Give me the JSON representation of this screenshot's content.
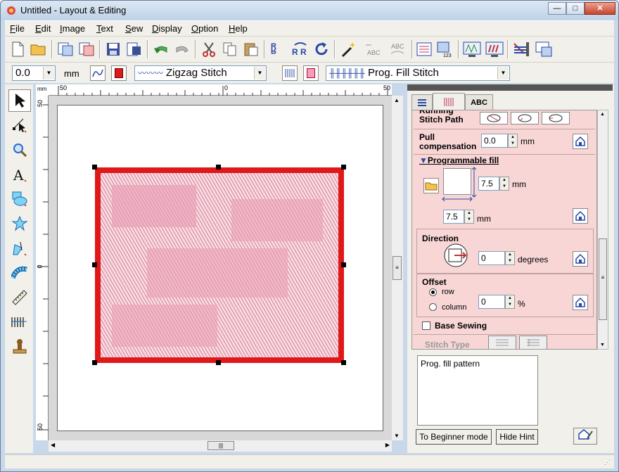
{
  "window": {
    "title": "Untitled - Layout & Editing",
    "minimize_label": "—",
    "maximize_label": "□",
    "close_label": "✕"
  },
  "menu": [
    {
      "key": "F",
      "rest": "ile"
    },
    {
      "key": "E",
      "rest": "dit"
    },
    {
      "key": "I",
      "rest": "mage"
    },
    {
      "key": "T",
      "rest": "ext"
    },
    {
      "key": "S",
      "rest": "ew"
    },
    {
      "key": "D",
      "rest": "isplay"
    },
    {
      "key": "O",
      "rest": "ption"
    },
    {
      "key": "H",
      "rest": "elp"
    }
  ],
  "toolbar2": {
    "size_value": "0.0",
    "unit": "mm",
    "line_stitch": "Zigzag Stitch",
    "region_stitch": "Prog. Fill Stitch"
  },
  "rulers": {
    "h_left": "50",
    "h_mid": "0",
    "h_right": "50",
    "v_top": "50",
    "v_mid": "0",
    "v_bottom": "50",
    "corner": "mm"
  },
  "tabs": {
    "text_tab": "ABC"
  },
  "properties": {
    "running_path_label": "Running\nStitch Path",
    "running_path_line2": "Stitch Path",
    "pull_comp_label1": "Pull",
    "pull_comp_label2": "compensation",
    "pull_comp_value": "0.0",
    "pull_comp_unit": "mm",
    "prog_fill_heading": "Programmable fill",
    "prog_fill_height": "7.5",
    "prog_fill_height_unit": "mm",
    "prog_fill_width": "7.5",
    "prog_fill_width_unit": "mm",
    "direction_label": "Direction",
    "direction_value": "0",
    "direction_unit": "degrees",
    "offset_label": "Offset",
    "offset_row": "row",
    "offset_column": "column",
    "offset_value": "0",
    "offset_unit": "%",
    "base_sewing_label": "Base Sewing",
    "stitch_type_label": "Stitch Type"
  },
  "hint": {
    "text": "Prog. fill pattern"
  },
  "buttons": {
    "beginner": "To Beginner mode",
    "hide_hint": "Hide Hint"
  },
  "colors": {
    "fill": "#e07890",
    "outline": "#e01818",
    "panel_pink": "#f8d6d6"
  }
}
